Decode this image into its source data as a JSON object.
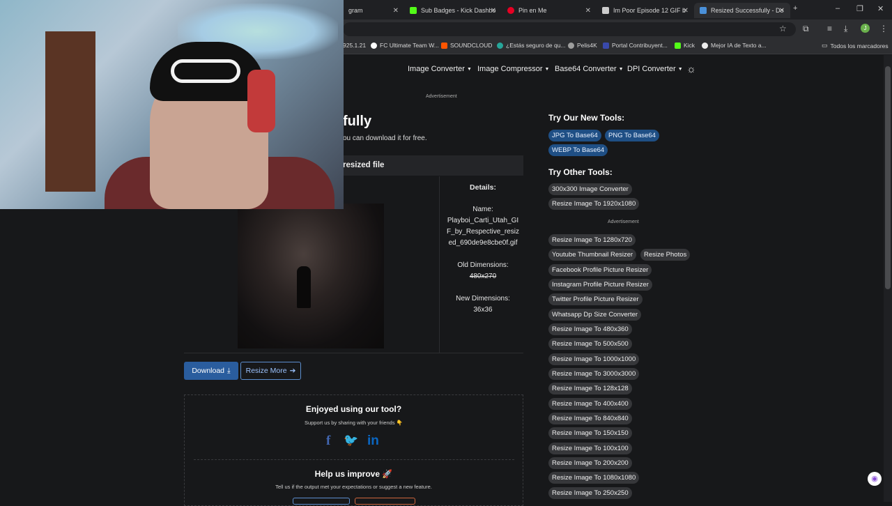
{
  "browser": {
    "tabs": [
      {
        "label": "gram",
        "favicon_color": "#d63384",
        "active": false
      },
      {
        "label": "Sub Badges - Kick Dashbo",
        "favicon_color": "#53fc18",
        "active": false
      },
      {
        "label": "Pin en Me",
        "favicon_color": "#e60023",
        "active": false
      },
      {
        "label": "Im Poor Episode 12 GIF b",
        "favicon_color": "#cccccc",
        "active": false
      },
      {
        "label": "Resized Successfully - Do",
        "favicon_color": "#4a90d9",
        "active": true
      }
    ],
    "new_tab": "+",
    "window_controls": [
      "–",
      "❐",
      "✕"
    ],
    "bookmarks": [
      {
        "label": "925.1.21",
        "favicon_color": "#9ccc65"
      },
      {
        "label": "FC Ultimate Team W...",
        "favicon_color": "#ffffff"
      },
      {
        "label": "SOUNDCLOUD",
        "favicon_color": "#ff5500"
      },
      {
        "label": "¿Estás seguro de qu...",
        "favicon_color": "#26a69a"
      },
      {
        "label": "Pelis4K",
        "favicon_color": "#9e9e9e"
      },
      {
        "label": "Portal Contribuyent...",
        "favicon_color": "#3949ab"
      },
      {
        "label": "Kick",
        "favicon_color": "#53fc18"
      },
      {
        "label": "Mejor IA de Texto a...",
        "favicon_color": "#eeeeee"
      }
    ],
    "all_bookmarks": "Todos los marcadores",
    "profile_initial": "J"
  },
  "nav": {
    "items": [
      "Image Converter",
      "Image Compressor",
      "Base64 Converter",
      "DPI Converter"
    ]
  },
  "ads": {
    "label": "Advertisement"
  },
  "result": {
    "title": "fully",
    "subtitle": "ou can download it for free.",
    "card_header": "resized file",
    "details_title": "Details:",
    "name_label": "Name:",
    "name_lines": [
      "Playboi_Carti_Utah_GI",
      "F_by_Respective_resiz",
      "ed_690de9e8cbe0f.gif"
    ],
    "old_label": "Old Dimensions:",
    "old_value": "480x270",
    "new_label": "New Dimensions:",
    "new_value": "36x36",
    "download_label": "Download",
    "download_icon": "⤓",
    "resize_more_label": "Resize More",
    "resize_more_icon": "➔"
  },
  "share": {
    "title": "Enjoyed using our tool?",
    "subtitle": "Support us by sharing with your friends 👇",
    "facebook": "f",
    "twitter": "🐦",
    "linkedin": "in",
    "help_title": "Help us improve 🚀",
    "help_subtitle": "Tell us if the output met your expectations or suggest a new feature."
  },
  "sidebar": {
    "new_tools_title": "Try Our New Tools:",
    "new_tools": [
      "JPG To Base64",
      "PNG To Base64",
      "WEBP To Base64"
    ],
    "other_tools_title": "Try Other Tools:",
    "other_tools_top": [
      "300x300 Image Converter",
      "Resize Image To 1920x1080"
    ],
    "other_tools": [
      "Resize Image To 1280x720",
      "Youtube Thumbnail Resizer",
      "Resize Photos",
      "Facebook Profile Picture Resizer",
      "Instagram Profile Picture Resizer",
      "Twitter Profile Picture Resizer",
      "Whatsapp Dp Size Converter",
      "Resize Image To 480x360",
      "Resize Image To 500x500",
      "Resize Image To 1000x1000",
      "Resize Image To 3000x3000",
      "Resize Image To 128x128",
      "Resize Image To 400x400",
      "Resize Image To 840x840",
      "Resize Image To 150x150",
      "Resize Image To 100x100",
      "Resize Image To 200x200",
      "Resize Image To 1080x1080",
      "Resize Image To 250x250"
    ]
  },
  "colors": {
    "page_bg": "#17181a",
    "accent": "#2a5d9e",
    "pill_blue": "#1f4f85",
    "facebook": "#4267b2",
    "twitter": "#1da1f2",
    "linkedin": "#0a66c2"
  }
}
